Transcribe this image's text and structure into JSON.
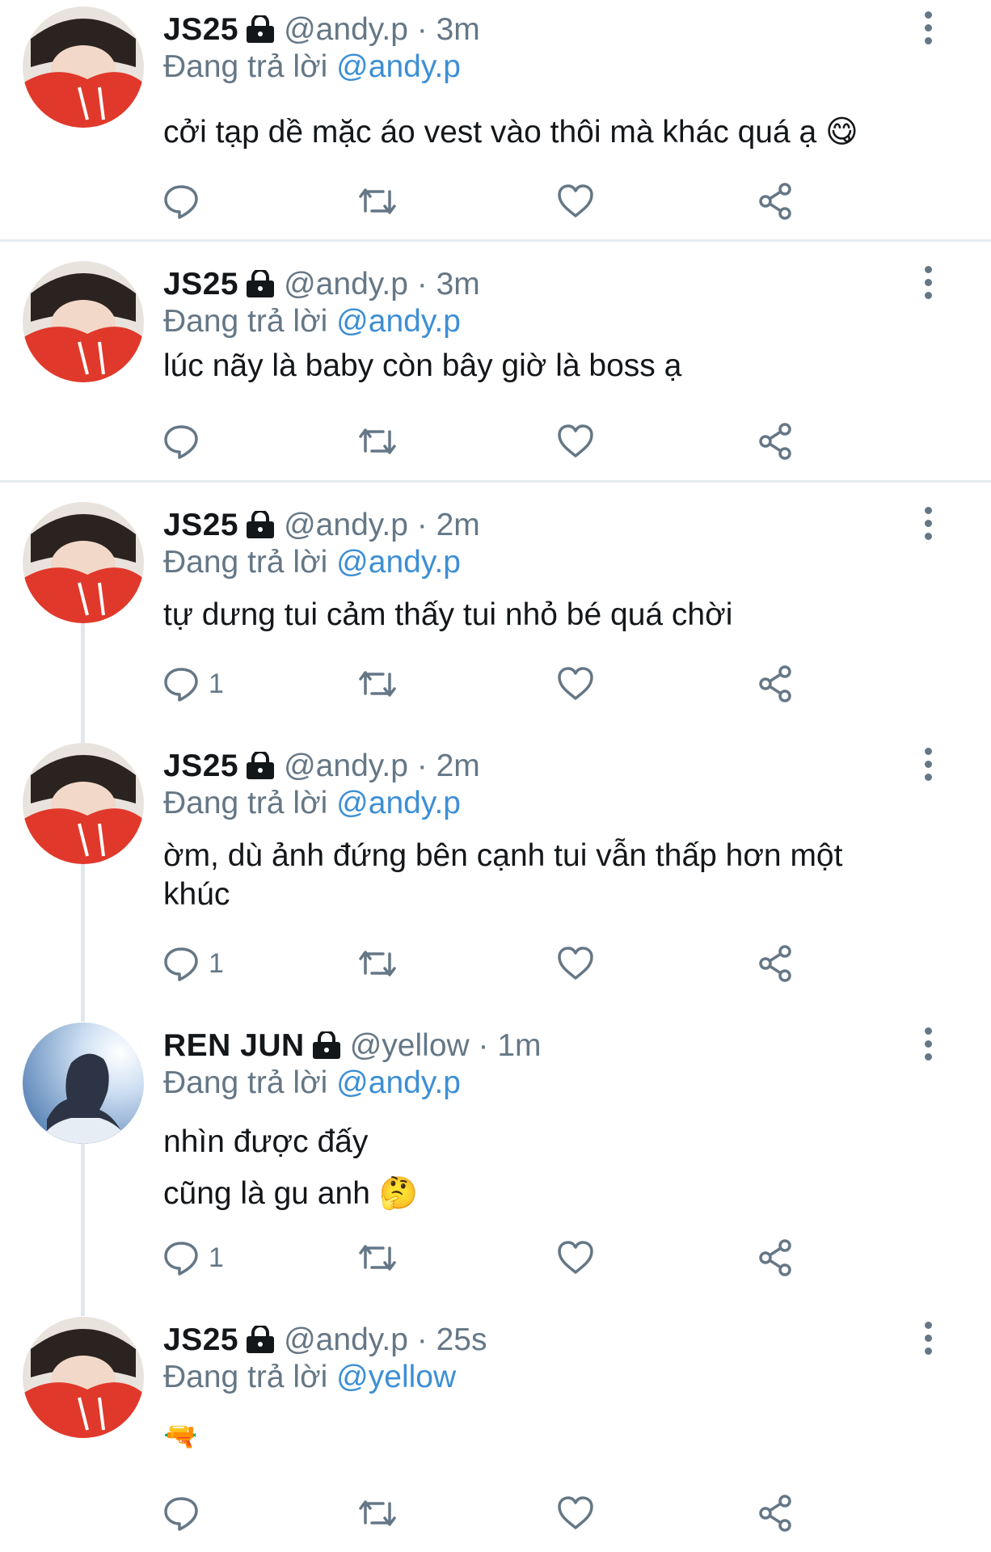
{
  "reply_prefix": "Đang trả lời",
  "tweets": [
    {
      "name": "JS25",
      "handle": "@andy.p",
      "dot": "·",
      "time": "3m",
      "reply_to": "@andy.p",
      "lines": [
        "cởi tạp dề mặc áo vest vào thôi mà khác quá ạ 😋"
      ],
      "reply_count": ""
    },
    {
      "name": "JS25",
      "handle": "@andy.p",
      "dot": "·",
      "time": "3m",
      "reply_to": "@andy.p",
      "lines": [
        "lúc nãy là baby còn bây giờ là boss ạ"
      ],
      "reply_count": ""
    },
    {
      "name": "JS25",
      "handle": "@andy.p",
      "dot": "·",
      "time": "2m",
      "reply_to": "@andy.p",
      "lines": [
        "tự dưng tui cảm thấy tui nhỏ bé quá chời"
      ],
      "reply_count": "1"
    },
    {
      "name": "JS25",
      "handle": "@andy.p",
      "dot": "·",
      "time": "2m",
      "reply_to": "@andy.p",
      "lines": [
        "ờm, dù ảnh đứng bên cạnh tui vẫn thấp hơn một khúc"
      ],
      "reply_count": "1"
    },
    {
      "name": "REN JUN",
      "handle": "@yellow",
      "dot": "·",
      "time": "1m",
      "reply_to": "@andy.p",
      "lines": [
        "nhìn được đấy",
        "cũng là gu anh 🤔"
      ],
      "reply_count": "1"
    },
    {
      "name": "JS25",
      "handle": "@andy.p",
      "dot": "·",
      "time": "25s",
      "reply_to": "@yellow",
      "lines": [
        "🔫"
      ],
      "reply_count": ""
    }
  ],
  "icons": {
    "reply": "reply-icon",
    "retweet": "retweet-icon",
    "like": "heart-icon",
    "share": "share-icon",
    "more": "more-vertical-icon",
    "lock": "lock-icon"
  },
  "colors": {
    "mention": "#3d8fd4",
    "meta": "#657786",
    "text": "#14171a",
    "divider": "#e6ecf0"
  }
}
